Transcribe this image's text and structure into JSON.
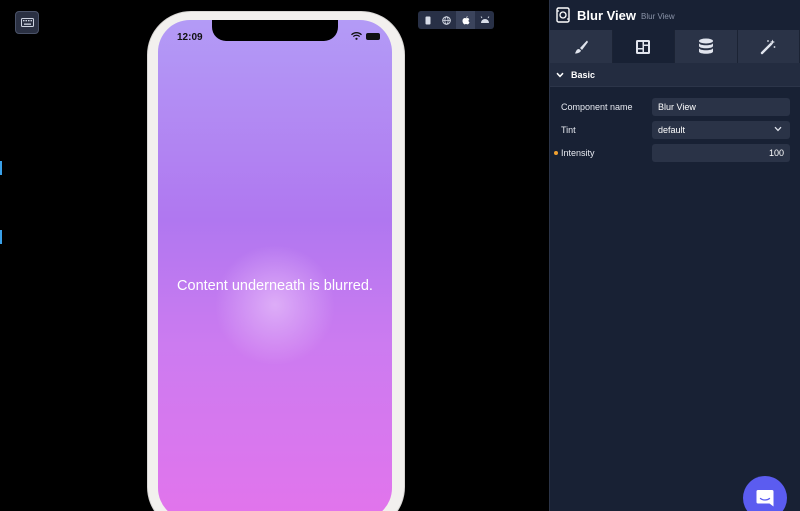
{
  "phone": {
    "status_time": "12:09",
    "content_text": "Content underneath is blurred."
  },
  "device_switcher": {
    "options": [
      "phone-icon",
      "globe-icon",
      "apple-icon",
      "android-icon"
    ],
    "active": "apple-icon"
  },
  "panel": {
    "title": "Blur View",
    "subtitle": "Blur View",
    "tabs": [
      "brush-icon",
      "layout-icon",
      "database-icon",
      "magic-wand-icon"
    ],
    "active_tab": "layout-icon",
    "section": {
      "title": "Basic",
      "expanded": true
    },
    "properties": {
      "component_name": {
        "label": "Component name",
        "value": "Blur View"
      },
      "tint": {
        "label": "Tint",
        "value": "default"
      },
      "intensity": {
        "label": "Intensity",
        "value": "100"
      }
    }
  },
  "colors": {
    "accent_blue": "#3aa0e8",
    "panel_bg": "#182134",
    "chat_bubble": "#5b5cf0",
    "modified_dot": "#f0a030",
    "gradient_top": "#b39bf6",
    "gradient_bottom": "#e274ec"
  }
}
